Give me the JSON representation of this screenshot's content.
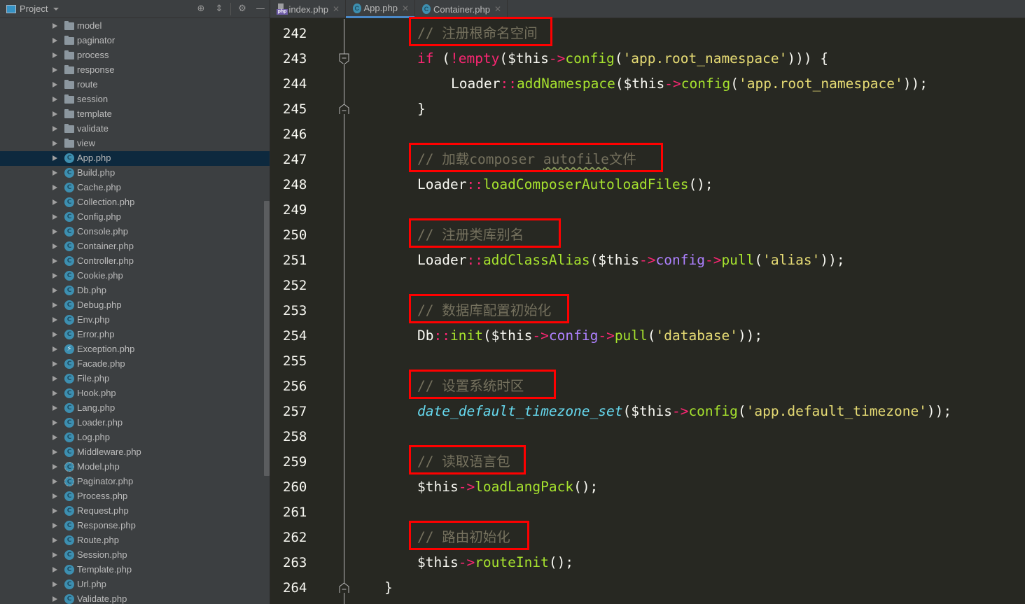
{
  "sidebar": {
    "title": "Project",
    "header_buttons": [
      {
        "name": "locate-icon",
        "glyph": "⊕"
      },
      {
        "name": "collapse-all-icon",
        "glyph": "⇕"
      },
      {
        "name": "gear-icon",
        "glyph": "⚙"
      },
      {
        "name": "minimize-icon",
        "glyph": "—"
      }
    ],
    "items": [
      {
        "label": "model",
        "type": "folder"
      },
      {
        "label": "paginator",
        "type": "folder"
      },
      {
        "label": "process",
        "type": "folder"
      },
      {
        "label": "response",
        "type": "folder"
      },
      {
        "label": "route",
        "type": "folder"
      },
      {
        "label": "session",
        "type": "folder"
      },
      {
        "label": "template",
        "type": "folder"
      },
      {
        "label": "validate",
        "type": "folder"
      },
      {
        "label": "view",
        "type": "folder"
      },
      {
        "label": "App.php",
        "type": "class",
        "selected": true
      },
      {
        "label": "Build.php",
        "type": "class"
      },
      {
        "label": "Cache.php",
        "type": "class"
      },
      {
        "label": "Collection.php",
        "type": "class"
      },
      {
        "label": "Config.php",
        "type": "class"
      },
      {
        "label": "Console.php",
        "type": "class"
      },
      {
        "label": "Container.php",
        "type": "class"
      },
      {
        "label": "Controller.php",
        "type": "class"
      },
      {
        "label": "Cookie.php",
        "type": "class"
      },
      {
        "label": "Db.php",
        "type": "class"
      },
      {
        "label": "Debug.php",
        "type": "class"
      },
      {
        "label": "Env.php",
        "type": "class"
      },
      {
        "label": "Error.php",
        "type": "class"
      },
      {
        "label": "Exception.php",
        "type": "exception"
      },
      {
        "label": "Facade.php",
        "type": "class"
      },
      {
        "label": "File.php",
        "type": "class"
      },
      {
        "label": "Hook.php",
        "type": "class"
      },
      {
        "label": "Lang.php",
        "type": "class"
      },
      {
        "label": "Loader.php",
        "type": "class"
      },
      {
        "label": "Log.php",
        "type": "class"
      },
      {
        "label": "Middleware.php",
        "type": "class"
      },
      {
        "label": "Model.php",
        "type": "abstract"
      },
      {
        "label": "Paginator.php",
        "type": "abstract"
      },
      {
        "label": "Process.php",
        "type": "class"
      },
      {
        "label": "Request.php",
        "type": "class"
      },
      {
        "label": "Response.php",
        "type": "class"
      },
      {
        "label": "Route.php",
        "type": "class"
      },
      {
        "label": "Session.php",
        "type": "class"
      },
      {
        "label": "Template.php",
        "type": "class"
      },
      {
        "label": "Url.php",
        "type": "class"
      },
      {
        "label": "Validate.php",
        "type": "class"
      }
    ]
  },
  "tabs": [
    {
      "label": "index.php",
      "icon": "php-file-icon",
      "active": false
    },
    {
      "label": "App.php",
      "icon": "class-icon",
      "active": true
    },
    {
      "label": "Container.php",
      "icon": "class-icon",
      "active": false
    }
  ],
  "editor": {
    "lines": [
      {
        "n": "242",
        "tokens": [
          [
            "c-com",
            "// 注册根命名空间"
          ]
        ],
        "indent": 2,
        "boxed": true
      },
      {
        "n": "243",
        "tokens": [
          [
            "c-kw",
            "if"
          ],
          [
            "c-plain",
            " ("
          ],
          [
            "c-kw",
            "!empty"
          ],
          [
            "c-plain",
            "($this"
          ],
          [
            "c-op",
            "->"
          ],
          [
            "c-fn",
            "config"
          ],
          [
            "c-plain",
            "("
          ],
          [
            "c-str",
            "'app.root_namespace'"
          ],
          [
            "c-plain",
            ")))"
          ],
          [
            "c-plain",
            " {"
          ]
        ],
        "indent": 2,
        "fold": "start"
      },
      {
        "n": "244",
        "tokens": [
          [
            "c-plain",
            "Loader"
          ],
          [
            "c-op",
            "::"
          ],
          [
            "c-fn",
            "addNamespace"
          ],
          [
            "c-plain",
            "($this"
          ],
          [
            "c-op",
            "->"
          ],
          [
            "c-fn",
            "config"
          ],
          [
            "c-plain",
            "("
          ],
          [
            "c-str",
            "'app.root_namespace'"
          ],
          [
            "c-plain",
            "));"
          ]
        ],
        "indent": 3
      },
      {
        "n": "245",
        "tokens": [
          [
            "c-plain",
            "}"
          ]
        ],
        "indent": 2,
        "fold": "end"
      },
      {
        "n": "246",
        "tokens": [],
        "indent": 2
      },
      {
        "n": "247",
        "tokens": [
          [
            "c-com",
            "// 加载composer "
          ],
          [
            "c-com squiggle",
            "autofile"
          ],
          [
            "c-com",
            "文件"
          ]
        ],
        "indent": 2,
        "boxed": true
      },
      {
        "n": "248",
        "tokens": [
          [
            "c-plain",
            "Loader"
          ],
          [
            "c-op",
            "::"
          ],
          [
            "c-fn",
            "loadComposerAutoloadFiles"
          ],
          [
            "c-plain",
            "();"
          ]
        ],
        "indent": 2
      },
      {
        "n": "249",
        "tokens": [],
        "indent": 2
      },
      {
        "n": "250",
        "tokens": [
          [
            "c-com",
            "// 注册类库别名"
          ]
        ],
        "indent": 2,
        "boxed": true
      },
      {
        "n": "251",
        "tokens": [
          [
            "c-plain",
            "Loader"
          ],
          [
            "c-op",
            "::"
          ],
          [
            "c-fn",
            "addClassAlias"
          ],
          [
            "c-plain",
            "($this"
          ],
          [
            "c-op",
            "->"
          ],
          [
            "c-prop",
            "config"
          ],
          [
            "c-op",
            "->"
          ],
          [
            "c-fn",
            "pull"
          ],
          [
            "c-plain",
            "("
          ],
          [
            "c-str",
            "'alias'"
          ],
          [
            "c-plain",
            "));"
          ]
        ],
        "indent": 2
      },
      {
        "n": "252",
        "tokens": [],
        "indent": 2
      },
      {
        "n": "253",
        "tokens": [
          [
            "c-com",
            "// 数据库配置初始化"
          ]
        ],
        "indent": 2,
        "boxed": true
      },
      {
        "n": "254",
        "tokens": [
          [
            "c-plain",
            "Db"
          ],
          [
            "c-op",
            "::"
          ],
          [
            "c-fn",
            "init"
          ],
          [
            "c-plain",
            "($this"
          ],
          [
            "c-op",
            "->"
          ],
          [
            "c-prop",
            "config"
          ],
          [
            "c-op",
            "->"
          ],
          [
            "c-fn",
            "pull"
          ],
          [
            "c-plain",
            "("
          ],
          [
            "c-str",
            "'database'"
          ],
          [
            "c-plain",
            "));"
          ]
        ],
        "indent": 2
      },
      {
        "n": "255",
        "tokens": [],
        "indent": 2
      },
      {
        "n": "256",
        "tokens": [
          [
            "c-com",
            "// 设置系统时区"
          ]
        ],
        "indent": 2,
        "boxed": true
      },
      {
        "n": "257",
        "tokens": [
          [
            "c-builtin",
            "date_default_timezone_set"
          ],
          [
            "c-plain",
            "($this"
          ],
          [
            "c-op",
            "->"
          ],
          [
            "c-fn",
            "config"
          ],
          [
            "c-plain",
            "("
          ],
          [
            "c-str",
            "'app.default_timezone'"
          ],
          [
            "c-plain",
            "));"
          ]
        ],
        "indent": 2
      },
      {
        "n": "258",
        "tokens": [],
        "indent": 2
      },
      {
        "n": "259",
        "tokens": [
          [
            "c-com",
            "// 读取语言包"
          ]
        ],
        "indent": 2,
        "boxed": true
      },
      {
        "n": "260",
        "tokens": [
          [
            "c-plain",
            "$this"
          ],
          [
            "c-op",
            "->"
          ],
          [
            "c-fn",
            "loadLangPack"
          ],
          [
            "c-plain",
            "();"
          ]
        ],
        "indent": 2
      },
      {
        "n": "261",
        "tokens": [],
        "indent": 2
      },
      {
        "n": "262",
        "tokens": [
          [
            "c-com",
            "// 路由初始化"
          ]
        ],
        "indent": 2,
        "boxed": true
      },
      {
        "n": "263",
        "tokens": [
          [
            "c-plain",
            "$this"
          ],
          [
            "c-op",
            "->"
          ],
          [
            "c-fn",
            "routeInit"
          ],
          [
            "c-plain",
            "();"
          ]
        ],
        "indent": 2
      },
      {
        "n": "264",
        "tokens": [
          [
            "c-plain",
            "}"
          ]
        ],
        "indent": 1,
        "fold": "end"
      }
    ]
  },
  "colors": {
    "editor_bg": "#272822",
    "sidebar_bg": "#3c3f41",
    "selection": "#0d293e",
    "comment": "#75715e",
    "keyword": "#f92672",
    "function": "#a6e22e",
    "string": "#e6db74",
    "property": "#ae81ff",
    "builtin": "#66d9ef",
    "annotation_box": "#ff0000"
  }
}
